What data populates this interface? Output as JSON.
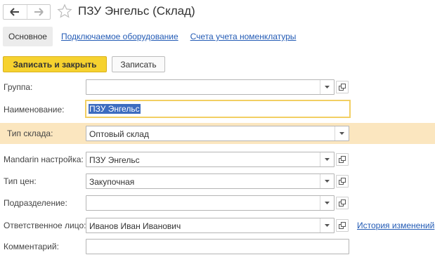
{
  "window": {
    "title": "ПЗУ Энгельс (Склад)",
    "nav_back_icon": "arrow-left-icon",
    "nav_forward_icon": "arrow-right-icon",
    "favorite_icon": "star-icon"
  },
  "tabs": {
    "active": "Основное",
    "links": [
      "Подключаемое оборудование",
      "Счета учета номенклатуры"
    ]
  },
  "toolbar": {
    "save_close_label": "Записать и закрыть",
    "save_label": "Записать"
  },
  "form": {
    "group": {
      "label": "Группа:",
      "value": ""
    },
    "name": {
      "label": "Наименование:",
      "value": "ПЗУ Энгельс"
    },
    "warehouse_type": {
      "label": "Тип склада:",
      "value": "Оптовый склад"
    },
    "mandarin": {
      "label": "Mandarin настройка:",
      "value": "ПЗУ Энгельс"
    },
    "price_type": {
      "label": "Тип цен:",
      "value": "Закупочная"
    },
    "department": {
      "label": "Подразделение:",
      "value": ""
    },
    "responsible": {
      "label": "Ответственное лицо:",
      "value": "Иванов Иван Иванович"
    },
    "comment": {
      "label": "Комментарий:",
      "value": ""
    }
  },
  "history_link": "История изменений",
  "colors": {
    "accent_yellow": "#f6d22f",
    "highlight_row": "#fbe6bf",
    "focus_border": "#f2cf63",
    "link_blue": "#235bb5",
    "selection_blue": "#3d6cc0"
  }
}
